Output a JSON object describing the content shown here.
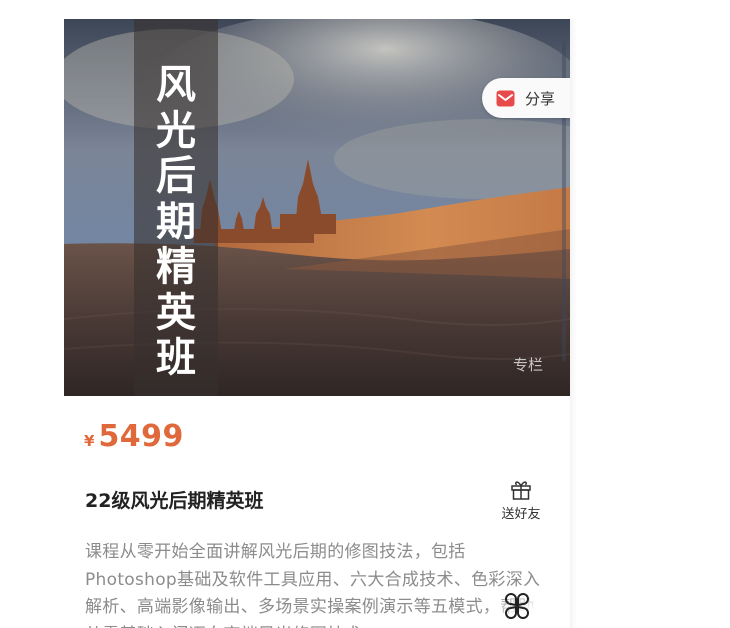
{
  "banner": {
    "title_chars": [
      "风",
      "光",
      "后",
      "期",
      "精",
      "英",
      "班"
    ],
    "tag": "专栏"
  },
  "share": {
    "label": "分享",
    "icon": "share-envelope-icon",
    "accent": "#e8494a"
  },
  "price": {
    "currency": "¥",
    "amount": "5499",
    "color": "#e0693c"
  },
  "course": {
    "title": "22级风光后期精英班",
    "description": "课程从零开始全面讲解风光后期的修图技法，包括Photoshop基础及软件工具应用、六大合成技术、色彩深入解析、高端影像输出、多场景实操案例演示等五模式，帮助从零基础入门迈向高端风光修图技术"
  },
  "gift": {
    "label": "送好友",
    "icon": "gift-icon"
  },
  "float_button": {
    "icon": "clover-menu-icon"
  }
}
